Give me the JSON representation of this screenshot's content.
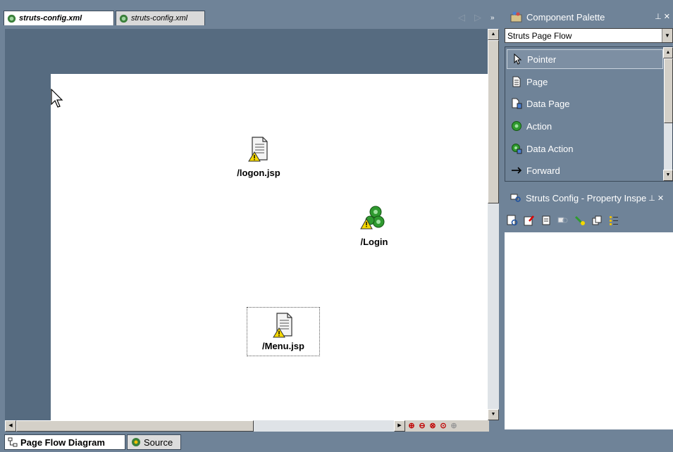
{
  "editor": {
    "tabs": [
      {
        "label": "struts-config.xml",
        "active": true
      },
      {
        "label": "struts-config.xml",
        "active": false
      }
    ]
  },
  "diagram": {
    "nodes": [
      {
        "label": "/logon.jsp",
        "icon": "jsp-page-warning-icon"
      },
      {
        "label": "/Login",
        "icon": "action-gear-warning-icon"
      },
      {
        "label": "/Menu.jsp",
        "icon": "jsp-page-warning-icon",
        "selected": true
      }
    ]
  },
  "bottom_tabs": [
    {
      "label": "Page Flow Diagram",
      "active": true,
      "icon": "diagram-icon"
    },
    {
      "label": "Source",
      "active": false,
      "icon": "source-icon"
    }
  ],
  "palette": {
    "title": "Component Palette",
    "selected_page": "Struts Page Flow",
    "items": [
      {
        "label": "Pointer",
        "icon": "pointer-icon",
        "selected": true
      },
      {
        "label": "Page",
        "icon": "page-icon"
      },
      {
        "label": "Data Page",
        "icon": "data-page-icon"
      },
      {
        "label": "Action",
        "icon": "action-icon"
      },
      {
        "label": "Data Action",
        "icon": "data-action-icon"
      },
      {
        "label": "Forward",
        "icon": "forward-arrow-icon"
      }
    ]
  },
  "inspector": {
    "title": "Struts Config - Property Inspe"
  },
  "colors": {
    "panel_bg": "#6f8398",
    "canvas_bg": "#ffffff",
    "warning": "#f5d800"
  }
}
